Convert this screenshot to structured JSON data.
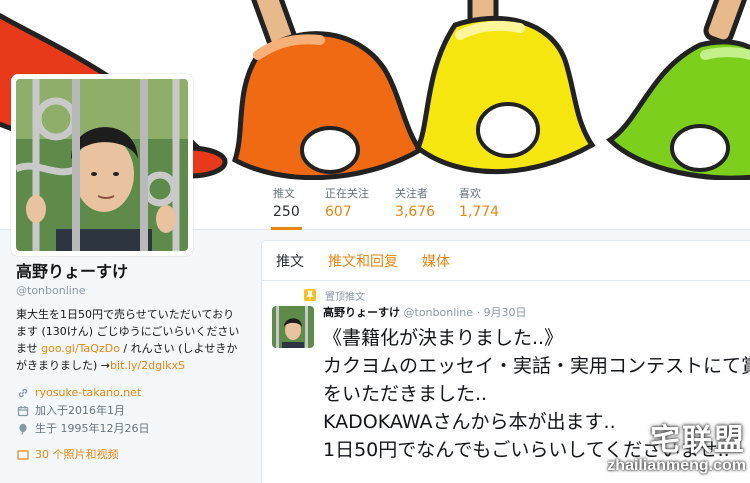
{
  "stats": [
    {
      "label": "推文",
      "value": "250"
    },
    {
      "label": "正在关注",
      "value": "607"
    },
    {
      "label": "关注者",
      "value": "3,676"
    },
    {
      "label": "喜欢",
      "value": "1,774"
    }
  ],
  "profile": {
    "name": "高野りょーすけ",
    "handle": "@tonbonline",
    "bio_part1": "東大生を1日50円で売らせていただいております (130けん) ごじゆうにごいらいくださいませ ",
    "bio_link1": "goo.gl/TaQzDo",
    "bio_part2": " / れんさい (しよせきかがきまりました) →",
    "bio_link2": "bit.ly/2dglkxS",
    "website": "ryosuke-takano.net",
    "joined": "加入于2016年1月",
    "born": "生于 1995年12月26日",
    "partial_row": "30 个照片和视频"
  },
  "tabs": [
    "推文",
    "推文和回复",
    "媒体"
  ],
  "tweet": {
    "pinned_label": "置顶推文",
    "name": "高野りょーすけ",
    "handle": "@tonbonline",
    "dot": "·",
    "time": "9月30日",
    "text": "《書籍化が決まりました..》\nカクヨムのエッセイ・実話・実用コンテストにて賞をいただきました..\nKADOKAWAさんから本が出ます..\n1日50円でなんでもごいらいしてくださいませ.."
  },
  "watermark": {
    "cn": "宅联盟",
    "url": "zhailianmeng.com"
  },
  "colors": {
    "accent": "#e8870f",
    "bg": "#f5f8fa",
    "text": "#14171a",
    "muted": "#8899a6"
  }
}
